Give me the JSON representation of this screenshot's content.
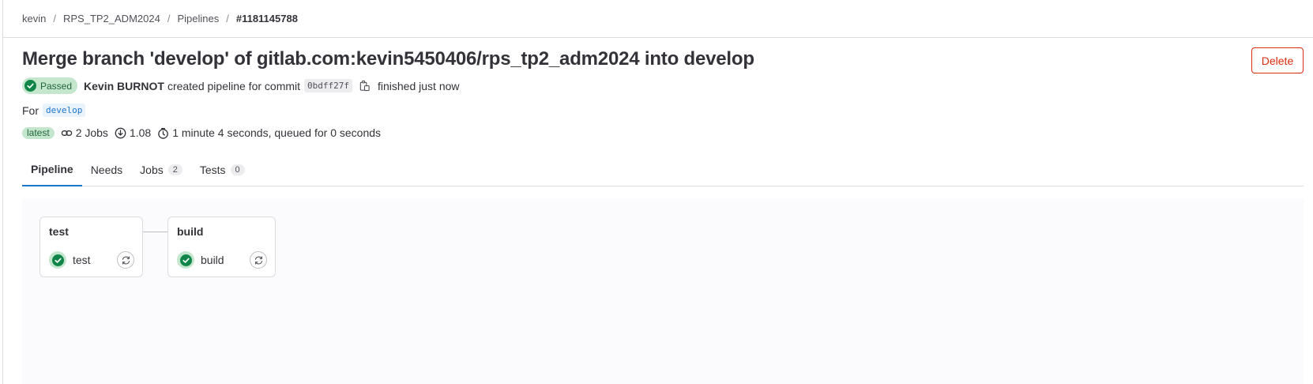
{
  "breadcrumb": [
    {
      "label": "kevin"
    },
    {
      "label": "RPS_TP2_ADM2024"
    },
    {
      "label": "Pipelines"
    },
    {
      "label": "#1181145788"
    }
  ],
  "header": {
    "title": "Merge branch 'develop' of gitlab.com:kevin5450406/rps_tp2_adm2024 into develop",
    "delete_label": "Delete",
    "status_label": "Passed",
    "author": "Kevin BURNOT",
    "created_text": "created pipeline for commit",
    "commit_sha": "0bdff27f",
    "finished_text": "finished just now",
    "for_label": "For",
    "ref": "develop",
    "latest_label": "latest",
    "jobs_text": "2 Jobs",
    "score_text": "1.08",
    "duration_text": "1 minute 4 seconds, queued for 0 seconds"
  },
  "tabs": [
    {
      "label": "Pipeline",
      "count": null,
      "active": true
    },
    {
      "label": "Needs",
      "count": null,
      "active": false
    },
    {
      "label": "Jobs",
      "count": "2",
      "active": false
    },
    {
      "label": "Tests",
      "count": "0",
      "active": false
    }
  ],
  "stages": [
    {
      "name": "test",
      "jobs": [
        {
          "name": "test",
          "status": "success"
        }
      ]
    },
    {
      "name": "build",
      "jobs": [
        {
          "name": "build",
          "status": "success"
        }
      ]
    }
  ],
  "colors": {
    "success_bg": "#c3e6cd",
    "success_fg": "#108548",
    "danger": "#dd2b0e",
    "link": "#1f75cb"
  },
  "icons": {
    "status": "status-success-icon",
    "copy": "copy-icon",
    "jobs": "link-icon",
    "score": "download-circle-icon",
    "duration": "clock-icon",
    "retry": "retry-icon"
  }
}
